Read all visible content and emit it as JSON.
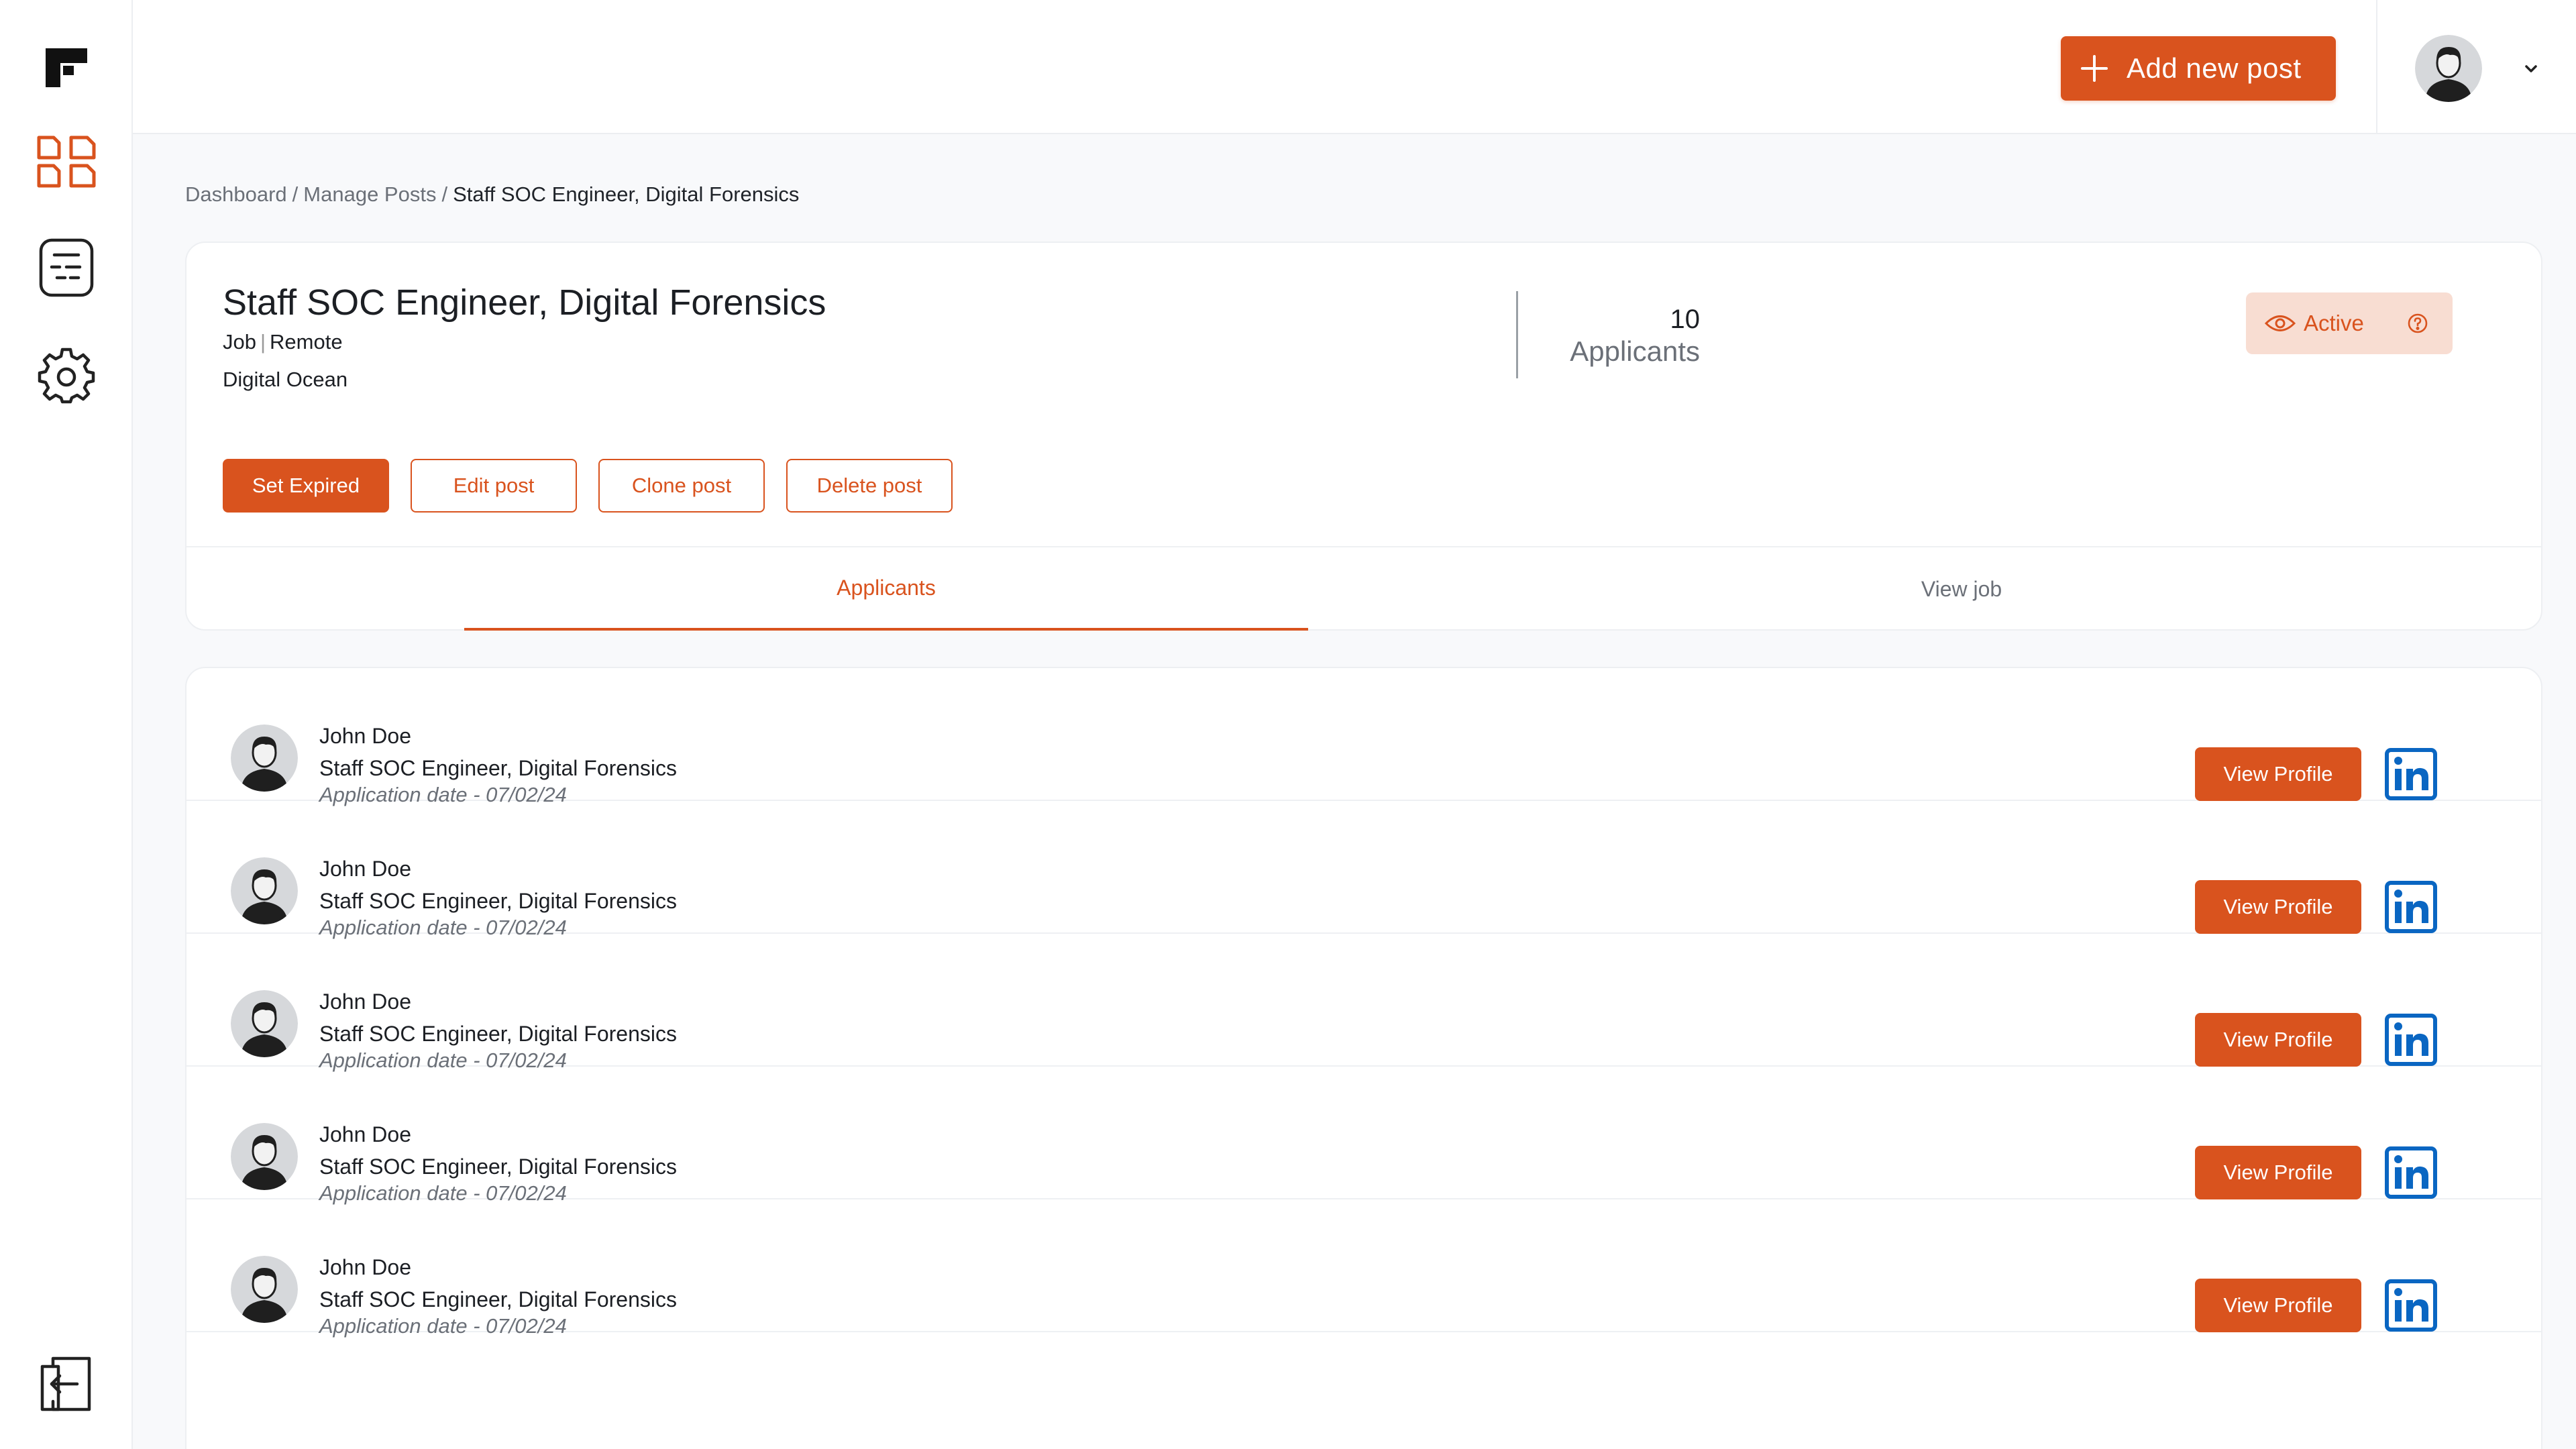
{
  "colors": {
    "accent": "#d9531e",
    "badge_bg": "#f8ddd2",
    "linkedin": "#0a66c2"
  },
  "sidebar": {
    "items": [
      {
        "name": "dashboard",
        "icon": "grid-icon",
        "active": true
      },
      {
        "name": "posts",
        "icon": "document-list-icon",
        "active": false
      },
      {
        "name": "settings",
        "icon": "gear-icon",
        "active": false
      }
    ],
    "logout_icon": "logout-icon"
  },
  "header": {
    "add_button_label": "Add new post",
    "add_icon": "plus-icon",
    "avatar_icon": "user-avatar-icon",
    "menu_icon": "chevron-down-icon"
  },
  "breadcrumb": {
    "items": [
      "Dashboard",
      "Manage Posts",
      "Staff SOC Engineer, Digital Forensics"
    ],
    "separator": "/"
  },
  "post": {
    "title": "Staff SOC Engineer, Digital Forensics",
    "type": "Job",
    "location": "Remote",
    "meta_separator": "|",
    "company": "Digital Ocean",
    "applicant_count": "10",
    "applicant_label": "Applicants",
    "status": "Active",
    "actions": {
      "expire": "Set Expired",
      "edit": "Edit post",
      "clone": "Clone post",
      "delete": "Delete post"
    },
    "tabs": {
      "applicants": "Applicants",
      "view_job": "View job"
    },
    "active_tab": "applicants"
  },
  "applicants": [
    {
      "name": "John Doe",
      "role": "Staff SOC Engineer, Digital Forensics",
      "date": "Application date - 07/02/24",
      "action": "View Profile"
    },
    {
      "name": "John Doe",
      "role": "Staff SOC Engineer, Digital Forensics",
      "date": "Application date - 07/02/24",
      "action": "View Profile"
    },
    {
      "name": "John Doe",
      "role": "Staff SOC Engineer, Digital Forensics",
      "date": "Application date - 07/02/24",
      "action": "View Profile"
    },
    {
      "name": "John Doe",
      "role": "Staff SOC Engineer, Digital Forensics",
      "date": "Application date - 07/02/24",
      "action": "View Profile"
    },
    {
      "name": "John Doe",
      "role": "Staff SOC Engineer, Digital Forensics",
      "date": "Application date - 07/02/24",
      "action": "View Profile"
    }
  ]
}
